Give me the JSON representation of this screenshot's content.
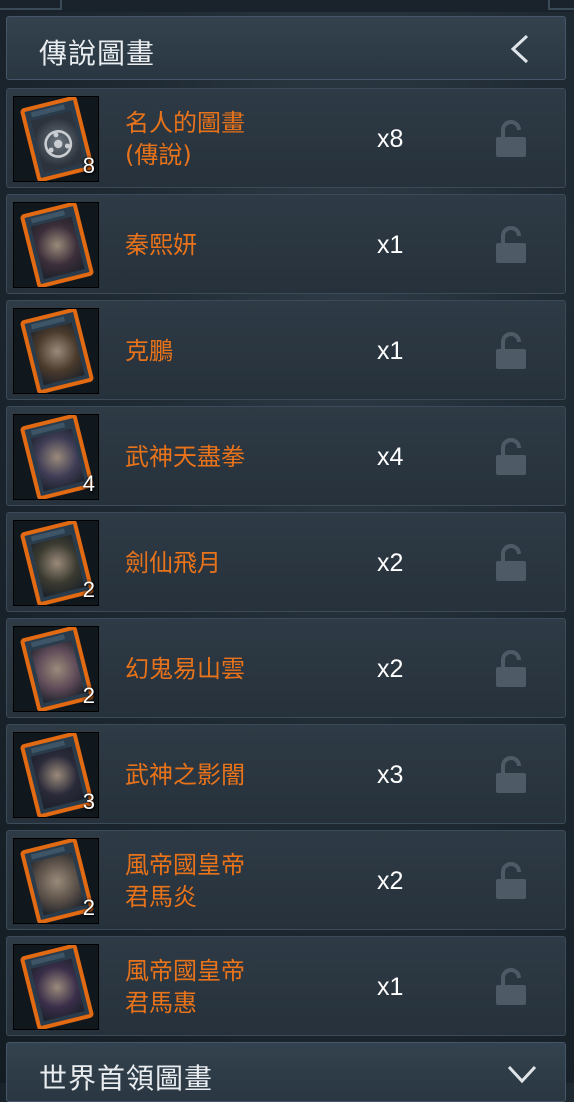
{
  "sections": {
    "legend": {
      "title": "傳說圖畫",
      "chevron_icon": "chevron-left-icon"
    },
    "world": {
      "title": "世界首領圖畫",
      "chevron_icon": "chevron-down-icon"
    }
  },
  "cards": [
    {
      "name": "名人的圖畫\n(傳說)",
      "qty": "x8",
      "count": "8",
      "locked": true
    },
    {
      "name": "秦熙妍",
      "qty": "x1",
      "count": "",
      "locked": true
    },
    {
      "name": "克鵬",
      "qty": "x1",
      "count": "",
      "locked": true
    },
    {
      "name": "武神天盡拳",
      "qty": "x4",
      "count": "4",
      "locked": true
    },
    {
      "name": "劍仙飛月",
      "qty": "x2",
      "count": "2",
      "locked": true
    },
    {
      "name": "幻鬼易山雲",
      "qty": "x2",
      "count": "2",
      "locked": true
    },
    {
      "name": "武神之影闇",
      "qty": "x3",
      "count": "3",
      "locked": true
    },
    {
      "name": "風帝國皇帝\n君馬炎",
      "qty": "x2",
      "count": "2",
      "locked": true
    },
    {
      "name": "風帝國皇帝\n君馬惠",
      "qty": "x1",
      "count": "",
      "locked": true
    }
  ],
  "colors": {
    "name": "#e8731a",
    "card_border": "#e26a12",
    "lock": "#4e5b66"
  }
}
